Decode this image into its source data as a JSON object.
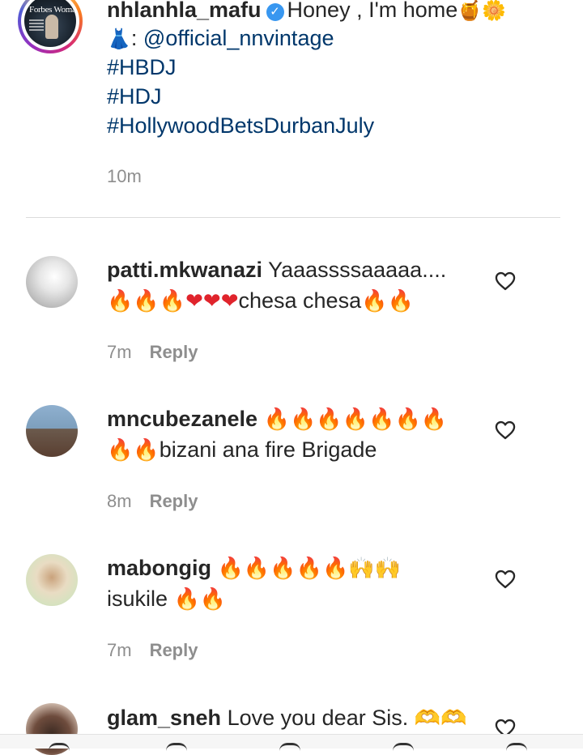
{
  "caption": {
    "username": "nhlanhla_mafu",
    "text": "Honey , I'm home",
    "emoji_after_text": "🍯🌼",
    "dress_emoji": "👗",
    "mention_prefix": ":",
    "mention": "@official_nnvintage",
    "hashtags": [
      "#HBDJ",
      "#HDJ",
      "#HollywoodBetsDurbanJuly"
    ],
    "time": "10m",
    "avatar_text": "Forbes Woman"
  },
  "comments": [
    {
      "username": "patti.mkwanazi",
      "line1": "Yaaassssaaaaa....",
      "line2_emoji_a": "🔥🔥🔥",
      "line2_emoji_b": "❤❤❤",
      "line2_text": "chesa chesa",
      "line2_emoji_c": "🔥🔥",
      "time": "7m",
      "reply": "Reply"
    },
    {
      "username": "mncubezanele",
      "line1_emoji": "🔥🔥🔥🔥🔥🔥🔥",
      "line2_emoji": "🔥🔥",
      "line2_text": "bizani ana fire Brigade",
      "time": "8m",
      "reply": "Reply"
    },
    {
      "username": "mabongig",
      "line1_emoji": "🔥🔥🔥🔥🔥",
      "line1_hands": "🙌🙌",
      "line2_text": "isukile",
      "line2_emoji": "🔥🔥",
      "time": "7m",
      "reply": "Reply"
    },
    {
      "username": "glam_sneh",
      "text": "Love you dear Sis.",
      "emoji": "🫶🫶"
    }
  ],
  "icons": {
    "like": "heart-outline-icon"
  },
  "colors": {
    "text": "#262626",
    "link": "#00376b",
    "meta": "#8e8e8e",
    "verified": "#3897f0",
    "divider": "#dbdbdb"
  }
}
